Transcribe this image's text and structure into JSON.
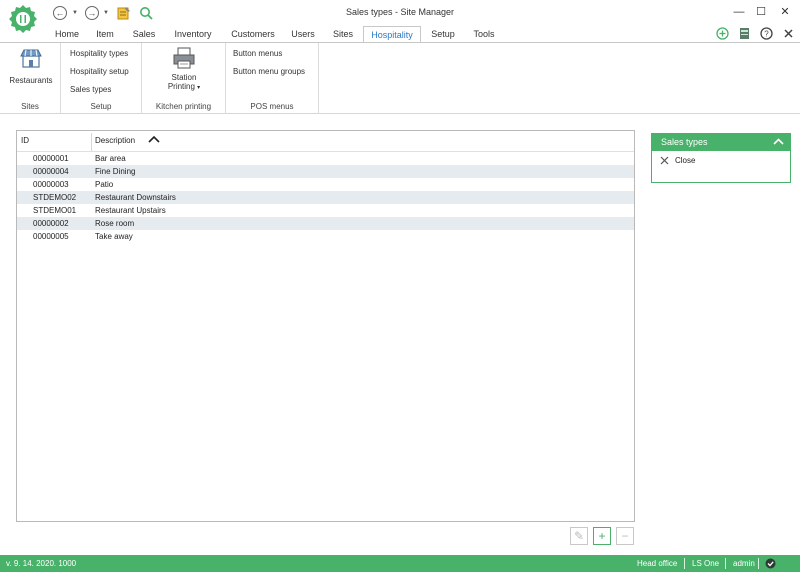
{
  "window": {
    "title": "Sales types - Site Manager",
    "controls": {
      "minimize": "—",
      "maximize": "☐",
      "close": "✕"
    }
  },
  "tabs": [
    {
      "label": "Home",
      "active": false
    },
    {
      "label": "Item",
      "active": false
    },
    {
      "label": "Sales",
      "active": false
    },
    {
      "label": "Inventory",
      "active": false
    },
    {
      "label": "Customers",
      "active": false
    },
    {
      "label": "Users",
      "active": false
    },
    {
      "label": "Sites",
      "active": false
    },
    {
      "label": "Hospitality",
      "active": true
    },
    {
      "label": "Setup",
      "active": false
    },
    {
      "label": "Tools",
      "active": false
    }
  ],
  "ribbon": {
    "sites": {
      "button": "Restaurants",
      "label": "Sites"
    },
    "setup": {
      "items": [
        "Hospitality types",
        "Hospitality setup",
        "Sales types"
      ],
      "label": "Setup"
    },
    "kitchen": {
      "button_line1": "Station",
      "button_line2": "Printing",
      "label": "Kitchen printing"
    },
    "pos": {
      "items": [
        "Button menus",
        "Button menu groups"
      ],
      "label": "POS menus"
    }
  },
  "grid": {
    "columns": [
      "ID",
      "Description"
    ],
    "sort_column": "Description",
    "rows": [
      {
        "id": "00000001",
        "description": "Bar area"
      },
      {
        "id": "00000004",
        "description": "Fine Dining"
      },
      {
        "id": "00000003",
        "description": "Patio"
      },
      {
        "id": "STDEMO02",
        "description": "Restaurant Downstairs"
      },
      {
        "id": "STDEMO01",
        "description": "Restaurant Upstairs"
      },
      {
        "id": "00000002",
        "description": "Rose room"
      },
      {
        "id": "00000005",
        "description": "Take away"
      }
    ],
    "buttons": {
      "edit": "✎",
      "add": "+",
      "remove": "−"
    }
  },
  "panel": {
    "title": "Sales types",
    "items": [
      {
        "label": "Close"
      }
    ]
  },
  "status": {
    "version": "v. 9. 14. 2020. 1000",
    "location": "Head office",
    "product": "LS One",
    "user": "admin"
  },
  "colors": {
    "accent": "#48b16a",
    "active_tab": "#2b78c5",
    "alt_row": "#e6ebef"
  },
  "icons": [
    "app-logo-icon",
    "back-icon",
    "forward-icon",
    "note-icon",
    "search-icon",
    "plus-circle-icon",
    "book-icon",
    "help-icon",
    "pin-icon",
    "store-icon",
    "printer-icon",
    "sort-up-icon",
    "close-x-icon",
    "check-icon"
  ]
}
